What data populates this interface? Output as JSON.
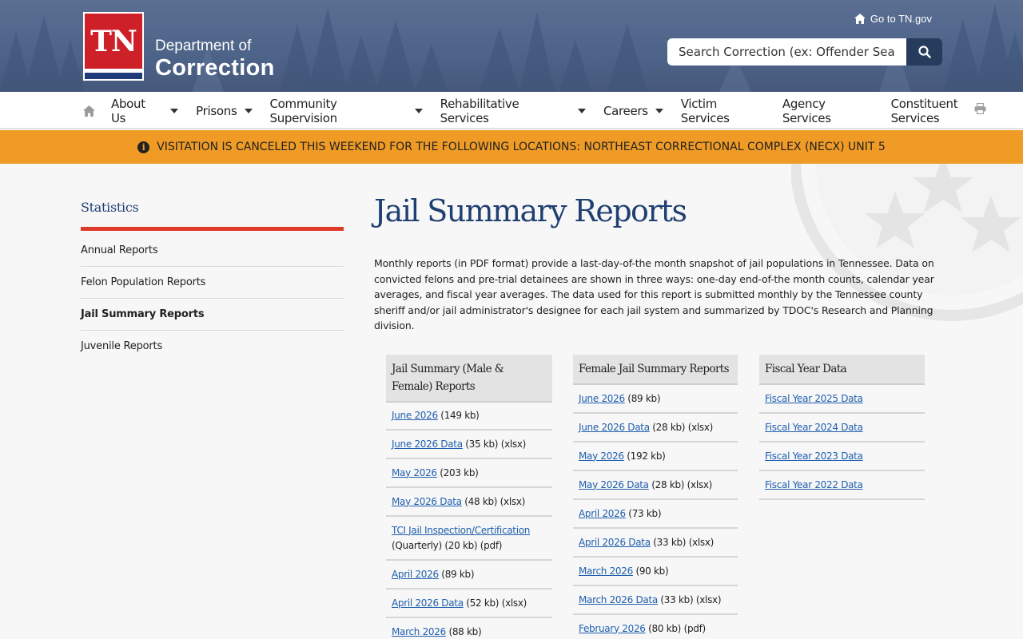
{
  "header": {
    "logo_letters": "TN",
    "logo_line1": "Department of",
    "logo_line2": "Correction",
    "goto_label": "Go to TN.gov",
    "search_placeholder": "Search Correction (ex: Offender Search)"
  },
  "nav": {
    "items": [
      {
        "label": "About Us",
        "dropdown": true
      },
      {
        "label": "Prisons",
        "dropdown": true
      },
      {
        "label": "Community Supervision",
        "dropdown": true
      },
      {
        "label": "Rehabilitative Services",
        "dropdown": true
      },
      {
        "label": "Careers",
        "dropdown": true
      },
      {
        "label": "Victim Services",
        "dropdown": false
      },
      {
        "label": "Agency Services",
        "dropdown": false
      },
      {
        "label": "Constituent Services",
        "dropdown": false
      }
    ]
  },
  "alert": {
    "text": "VISITATION IS CANCELED THIS WEEKEND FOR THE FOLLOWING LOCATIONS: NORTHEAST CORRECTIONAL COMPLEX (NECX) UNIT 5"
  },
  "sidebar": {
    "title": "Statistics",
    "items": [
      {
        "label": "Annual Reports",
        "active": false
      },
      {
        "label": "Felon Population Reports",
        "active": false
      },
      {
        "label": "Jail Summary Reports",
        "active": true
      },
      {
        "label": "Juvenile Reports",
        "active": false
      }
    ]
  },
  "main": {
    "title": "Jail Summary Reports",
    "intro": "Monthly reports (in PDF format) provide a last-day-of-the month snapshot of jail populations in Tennessee. Data on convicted felons and pre-trial detainees are shown in three ways: one-day end-of-the month counts, calendar year averages, and fiscal year averages.  The data used for this report is submitted monthly by the Tennessee county sheriff and/or jail administrator's designee for each jail system and summarized by TDOC's Research and Planning division.",
    "columns": [
      {
        "heading": "Jail Summary (Male & Female) Reports",
        "rows": [
          {
            "link": "June 2026",
            "suffix": " (149 kb)"
          },
          {
            "link": "June 2026 Data",
            "suffix": " (35 kb) (xlsx)"
          },
          {
            "link": "May 2026",
            "suffix": " (203 kb)"
          },
          {
            "link": "May 2026 Data",
            "suffix": " (48 kb) (xlsx)"
          },
          {
            "link": "TCI Jail Inspection/Certification",
            "suffix": " (Quarterly) (20 kb) (pdf)"
          },
          {
            "link": "April 2026",
            "suffix": " (89 kb)"
          },
          {
            "link": "April 2026 Data",
            "suffix": " (52 kb)  (xlsx)"
          },
          {
            "link": "March 2026",
            "suffix": " (88 kb)"
          }
        ]
      },
      {
        "heading": "Female Jail Summary Reports",
        "rows": [
          {
            "link": "June 2026",
            "suffix": " (89 kb)"
          },
          {
            "link": "June 2026 Data",
            "suffix": " (28 kb)  (xlsx)"
          },
          {
            "link": "May 2026",
            "suffix": " (192 kb)"
          },
          {
            "link": "May 2026 Data",
            "suffix": " (28 kb)  (xlsx)"
          },
          {
            "link": "April 2026",
            "suffix": " (73 kb)"
          },
          {
            "link": "April 2026 Data",
            "suffix": " (33 kb)  (xlsx)"
          },
          {
            "link": "March 2026",
            "suffix": " (90 kb)"
          },
          {
            "link": "March 2026 Data",
            "suffix": " (33 kb) (xlsx)"
          },
          {
            "link": "February 2026",
            "suffix": " (80 kb) (pdf)"
          }
        ]
      },
      {
        "heading": "Fiscal Year Data",
        "rows": [
          {
            "link": "Fiscal Year 2025 Data",
            "suffix": ""
          },
          {
            "link": "Fiscal Year 2024 Data",
            "suffix": ""
          },
          {
            "link": "Fiscal Year 2023 Data",
            "suffix": ""
          },
          {
            "link": "Fiscal Year 2022 Data",
            "suffix": ""
          }
        ]
      }
    ]
  },
  "colors": {
    "header_bg": "#4d6388",
    "brand_red": "#ce2029",
    "title_blue": "#1f3f72",
    "alert_orange": "#ef9b26",
    "link_blue": "#1f5fae",
    "sidebar_accent": "#de3a2b"
  }
}
